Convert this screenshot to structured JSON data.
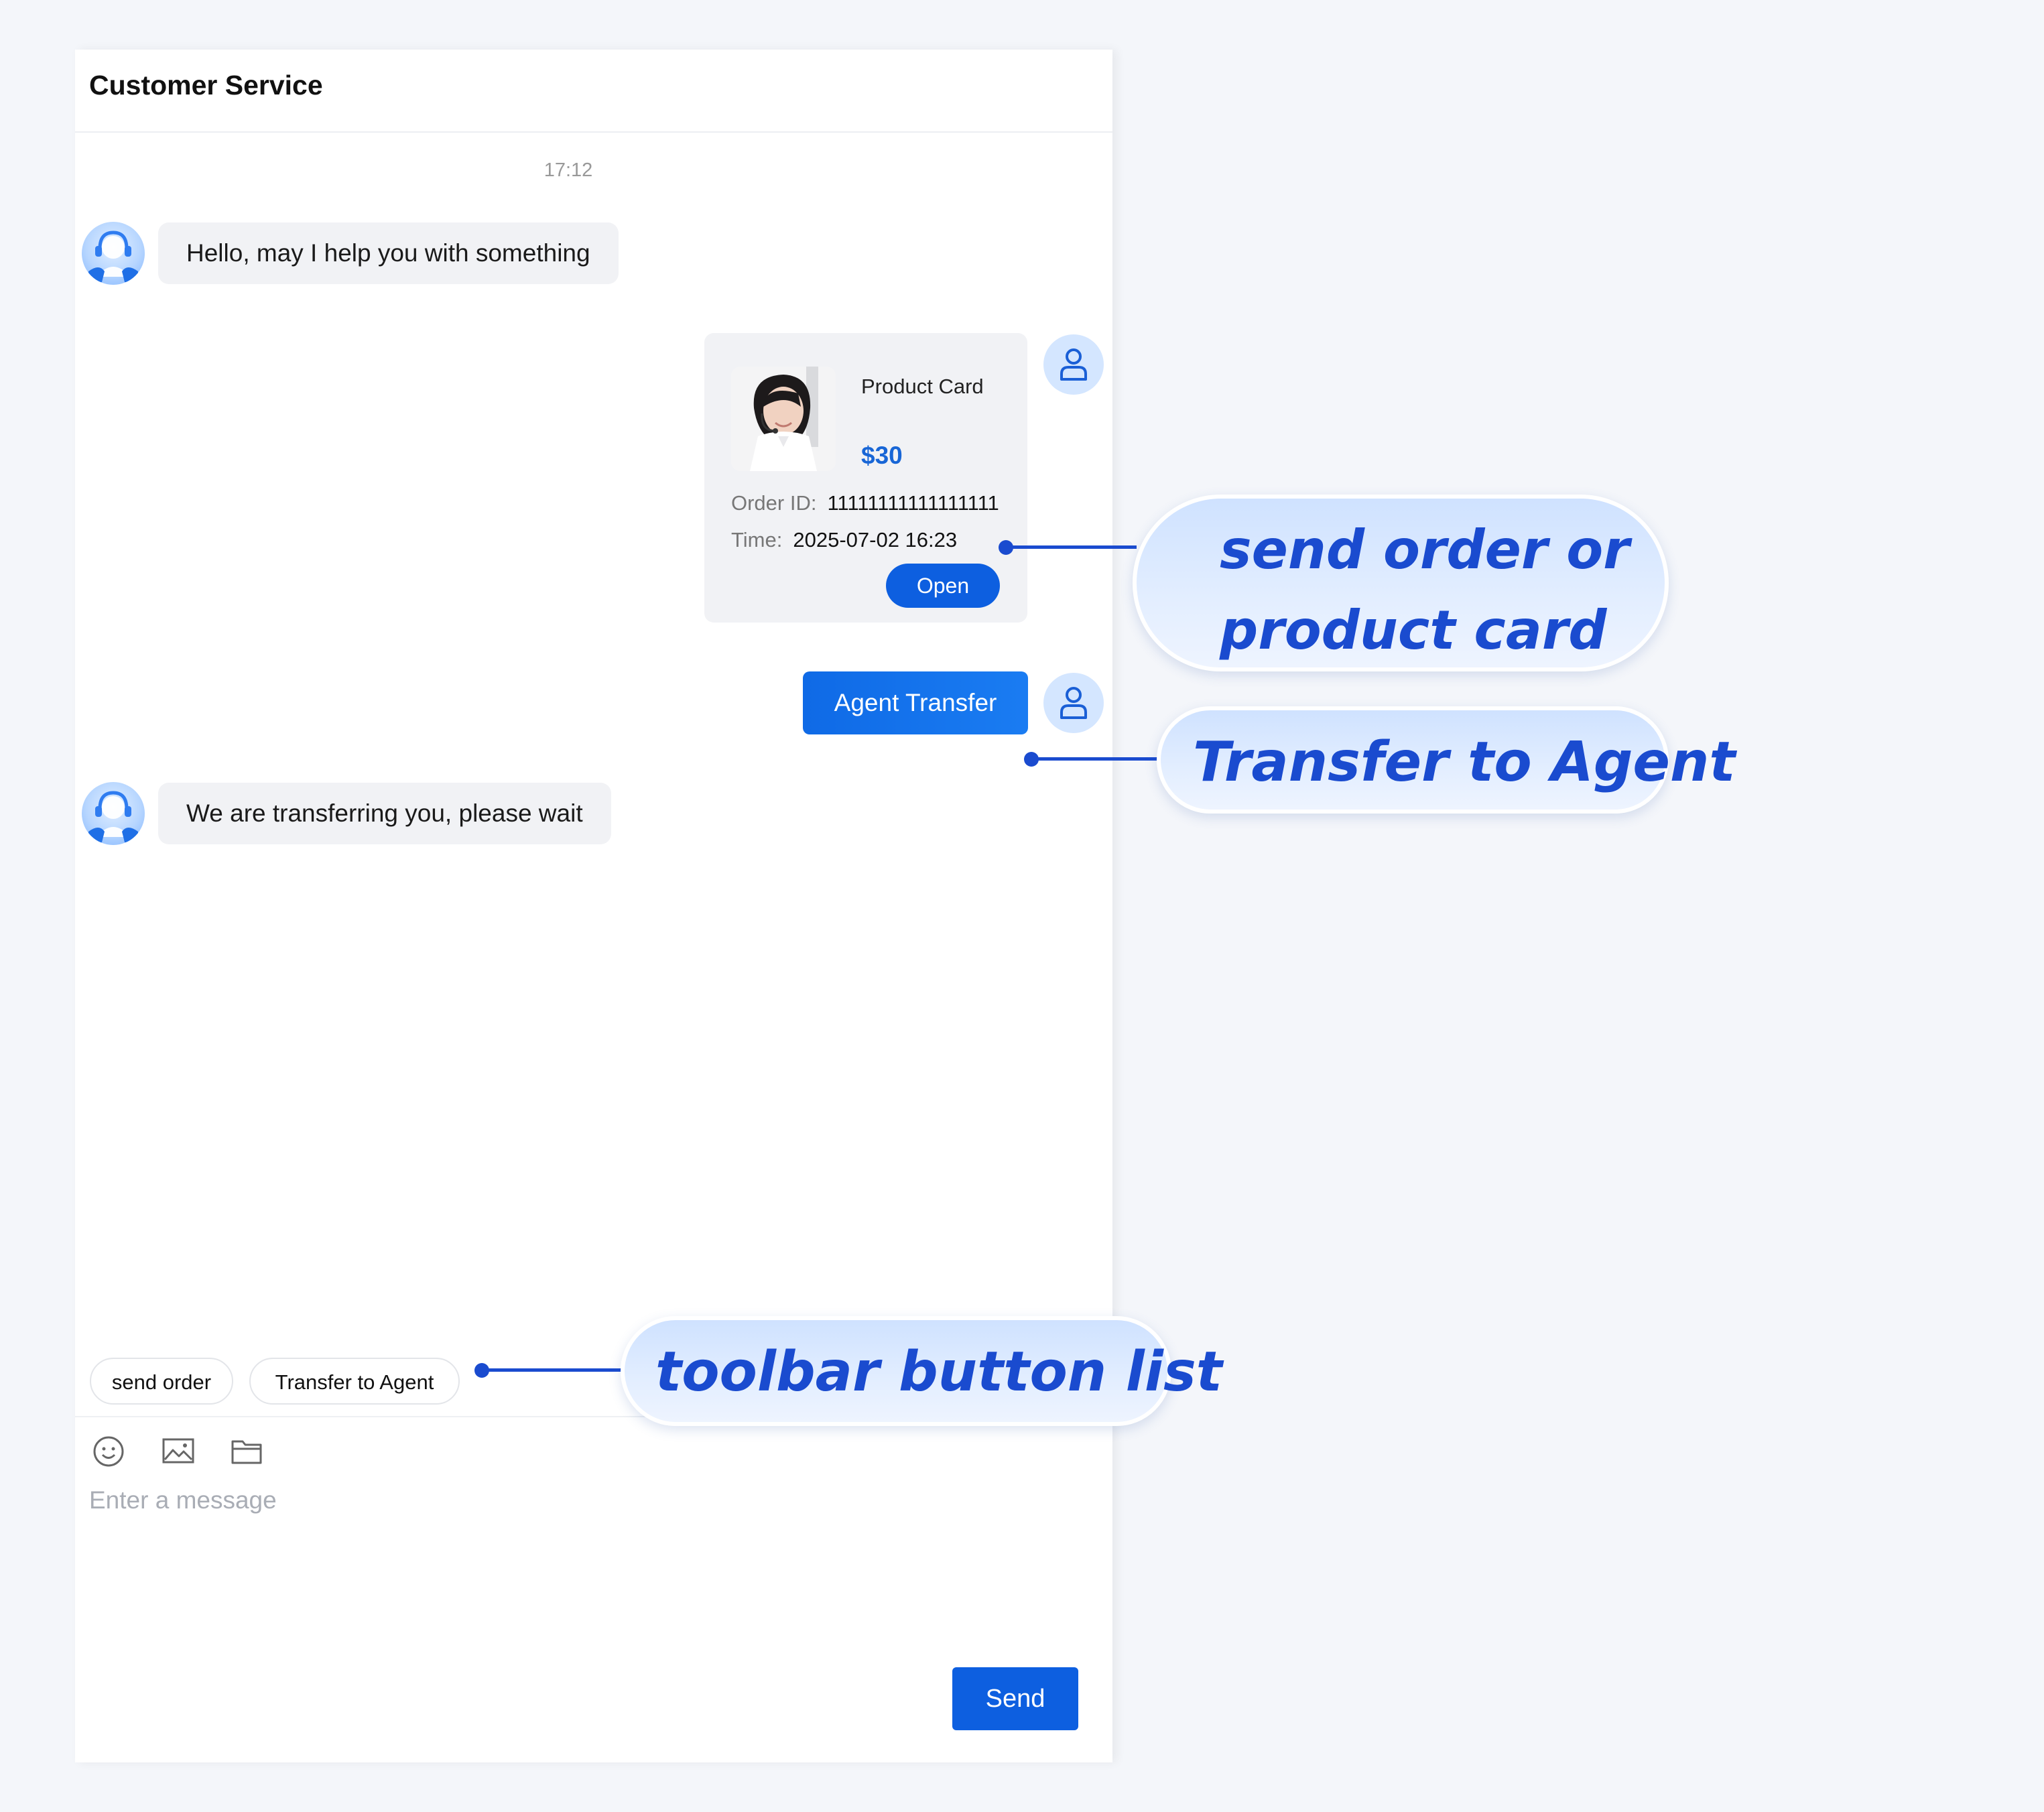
{
  "header": {
    "title": "Customer Service"
  },
  "messages": {
    "timestamp": "17:12",
    "greeting": "Hello, may I help you with something",
    "transferring": "We are transferring you, please wait",
    "agent_transfer": "Agent Transfer"
  },
  "product_card": {
    "title": "Product Card",
    "price": "$30",
    "order_id_label": "Order ID:",
    "order_id_value": "11111111111111111",
    "time_label": "Time:",
    "time_value": "2025-07-02 16:23",
    "open_label": "Open"
  },
  "toolbar": {
    "chips": [
      "send order",
      "Transfer to Agent"
    ],
    "icons": [
      "emoji-icon",
      "image-icon",
      "folder-icon"
    ]
  },
  "input": {
    "placeholder": "Enter a message"
  },
  "send_label": "Send",
  "callouts": {
    "card_line1": "send order or",
    "card_line2": "product card",
    "transfer": "Transfer to Agent",
    "toolbar": "toolbar button list"
  },
  "colors": {
    "accent": "#0d5fe0",
    "callout_text": "#1a4bcf",
    "bubble_bg": "#f1f2f5",
    "page_bg": "#f4f6fa"
  }
}
